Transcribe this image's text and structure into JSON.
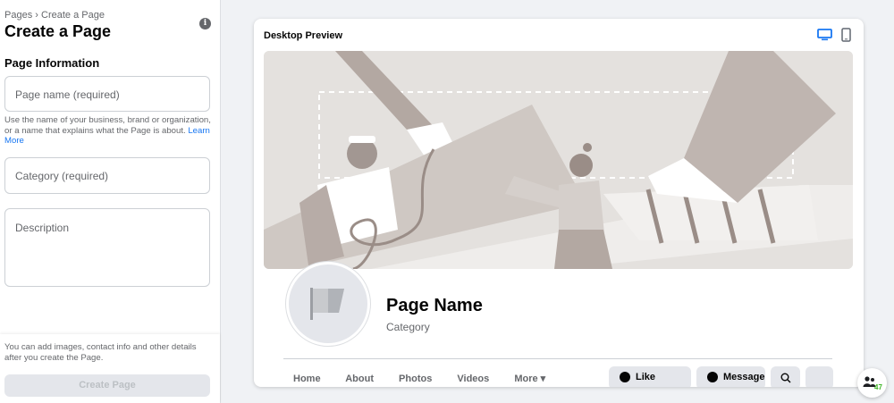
{
  "breadcrumb": {
    "parent": "Pages",
    "separator": "›",
    "current": "Create a Page"
  },
  "heading": "Create a Page",
  "info_icon": "info-icon",
  "form": {
    "section_title": "Page Information",
    "name_placeholder": "Page name (required)",
    "name_hint": "Use the name of your business, brand or organization, or a name that explains what the Page is about.",
    "learn_more": "Learn More",
    "category_placeholder": "Category (required)",
    "description_placeholder": "Description"
  },
  "footer": {
    "note": "You can add images, contact info and other details after you create the Page.",
    "create_label": "Create Page"
  },
  "preview": {
    "title": "Desktop Preview",
    "desktop_icon": "desktop-icon",
    "mobile_icon": "mobile-icon",
    "page_name": "Page Name",
    "category": "Category",
    "tabs": [
      "Home",
      "About",
      "Photos",
      "Videos",
      "More ▾"
    ],
    "actions": {
      "like": "Like",
      "message": "Message"
    }
  },
  "floating_badge": {
    "icon": "people-icon",
    "count": "47"
  },
  "colors": {
    "accent": "#1877f2",
    "background": "#f0f2f5",
    "disabled_button": "#e4e6eb"
  }
}
